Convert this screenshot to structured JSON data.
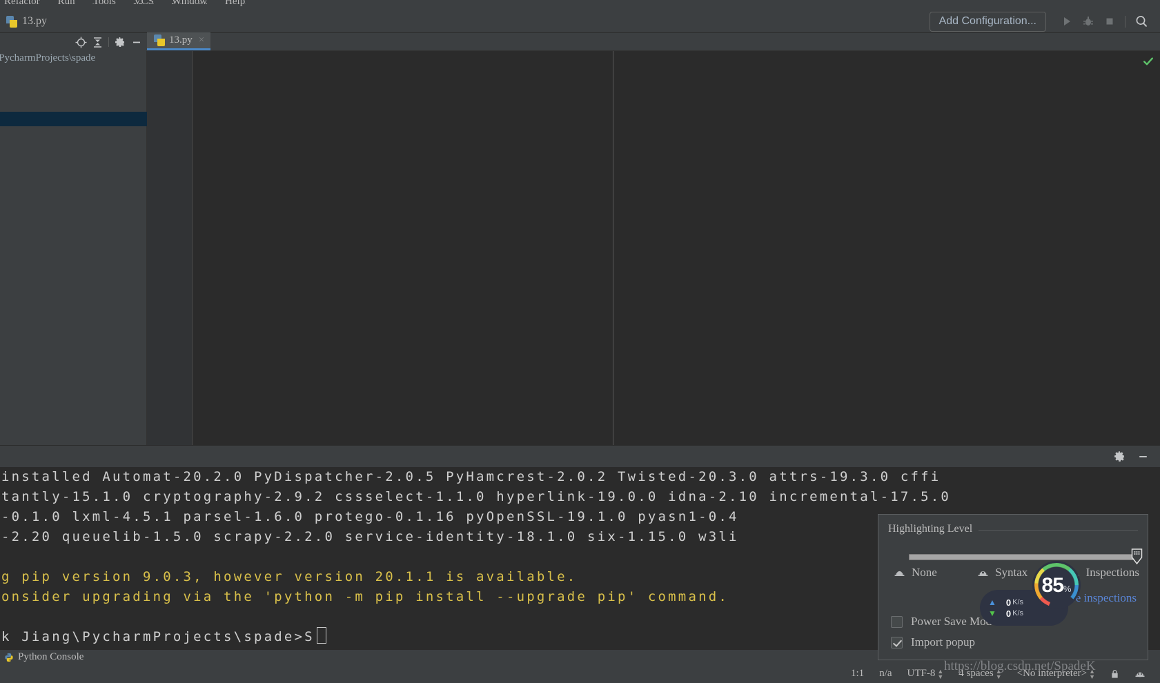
{
  "menubar": {
    "items": [
      {
        "label": "Refactor"
      },
      {
        "label": "Run"
      },
      {
        "label": "Tools"
      },
      {
        "label": "VCS"
      },
      {
        "label": "Window"
      },
      {
        "label": "Help"
      }
    ]
  },
  "toolbar": {
    "file_title": "13.py",
    "add_configuration_label": "Add Configuration...",
    "icons": {
      "run": "run-icon",
      "debug": "debug-icon",
      "stop": "stop-icon",
      "search": "search-icon"
    }
  },
  "left_pane": {
    "header_icons": [
      "locate-icon",
      "collapse-all-icon",
      "gear-icon",
      "hide-icon"
    ],
    "tree": {
      "path_label": "\\PycharmProjects\\spade",
      "selected_label": ""
    }
  },
  "editor": {
    "tabs": [
      {
        "label": "13.py",
        "icon": "python-file-icon",
        "active": true,
        "close": "×"
      }
    ],
    "inspection_status": "ok-check-icon"
  },
  "console": {
    "header_icons": [
      "gear-icon",
      "hide-icon"
    ],
    "lines": [
      {
        "text": "installed Automat-20.2.0 PyDispatcher-2.0.5 PyHamcrest-2.0.2 Twisted-20.3.0 attrs-19.3.0 cffi",
        "style": "normal"
      },
      {
        "text": "tantly-15.1.0 cryptography-2.9.2 cssselect-1.1.0 hyperlink-19.0.0 idna-2.10 incremental-17.5.0",
        "style": "normal"
      },
      {
        "text": "-0.1.0 lxml-4.5.1 parsel-1.6.0 protego-0.1.16 pyOpenSSL-19.1.0 pyasn1-0.4",
        "style": "normal"
      },
      {
        "text": "-2.20 queuelib-1.5.0 scrapy-2.2.0 service-identity-18.1.0 six-1.15.0 w3li",
        "style": "normal"
      },
      {
        "text": "",
        "style": "blank"
      },
      {
        "text": "g pip version 9.0.3, however version 20.1.1 is available.",
        "style": "warn"
      },
      {
        "text": "onsider upgrading via the 'python -m pip install --upgrade pip' command.",
        "style": "warn"
      },
      {
        "text": "",
        "style": "blank"
      },
      {
        "text": "k Jiang\\PycharmProjects\\spade>S",
        "style": "prompt"
      }
    ],
    "footer_tab": "Python Console"
  },
  "highlighting_popup": {
    "title": "Highlighting Level",
    "levels": [
      {
        "label": "None",
        "icon": "hat-none-icon"
      },
      {
        "label": "Syntax",
        "icon": "hat-syntax-icon"
      },
      {
        "label": "Inspections",
        "icon": "hat-inspections-icon"
      }
    ],
    "slider_value": 100,
    "configure_link": "Configure inspections",
    "checkboxes": [
      {
        "label": "Power Save Mode",
        "checked": false,
        "mnemonic": ""
      },
      {
        "label": "Import popup",
        "checked": true,
        "mnemonic": "po"
      }
    ]
  },
  "network_widget": {
    "upload": "0",
    "upload_unit": "K/s",
    "download": "0",
    "download_unit": "K/s",
    "cpu_value": "85",
    "cpu_unit": "%"
  },
  "statusbar": {
    "items": [
      {
        "label": "1:1",
        "caret": false
      },
      {
        "label": "n/a",
        "caret": false
      },
      {
        "label": "UTF-8",
        "caret": true
      },
      {
        "label": "4 spaces",
        "caret": true
      },
      {
        "label": "<No interpreter>",
        "caret": true
      }
    ],
    "lock_icon": "lock-icon",
    "inspection_icon": "hat-inspections-icon"
  },
  "watermark": "https://blog.csdn.net/SpadeK",
  "colors": {
    "panel_bg": "#3c3f41",
    "editor_bg": "#2b2b2b",
    "accent_tab": "#4a88c7",
    "link": "#5a86d8",
    "warn_text": "#d9c04a",
    "selection": "#0d293e",
    "ok_green": "#5ec46a"
  }
}
